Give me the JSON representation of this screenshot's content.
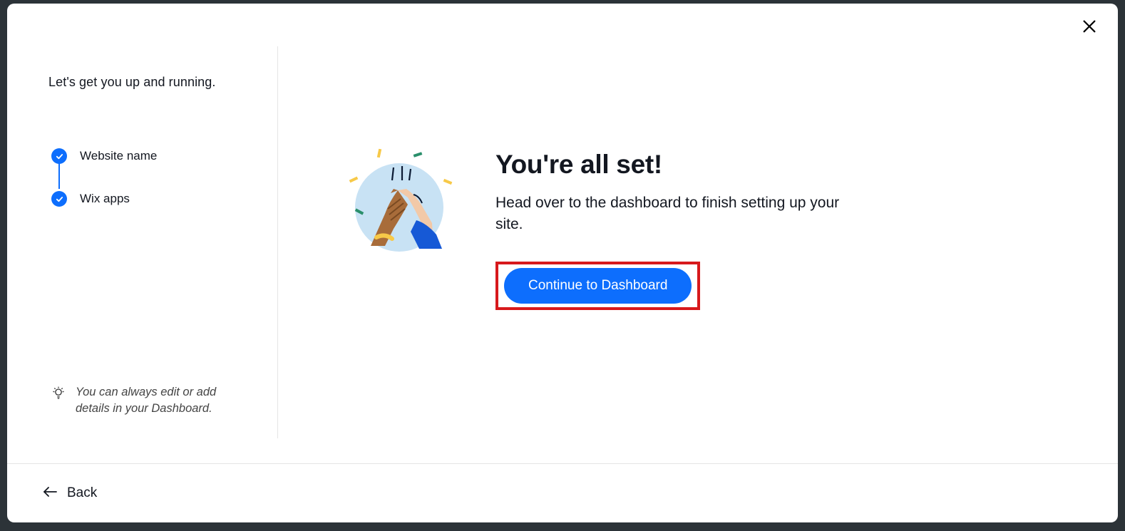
{
  "sidebar": {
    "title": "Let's get you up and running.",
    "steps": [
      {
        "label": "Website name",
        "done": true
      },
      {
        "label": "Wix apps",
        "done": true
      }
    ],
    "hint": "You can always edit or add details in your Dashboard."
  },
  "main": {
    "heading": "You're all set!",
    "subtext": "Head over to the dashboard to finish setting up your site.",
    "cta_label": "Continue to Dashboard"
  },
  "footer": {
    "back_label": "Back"
  }
}
